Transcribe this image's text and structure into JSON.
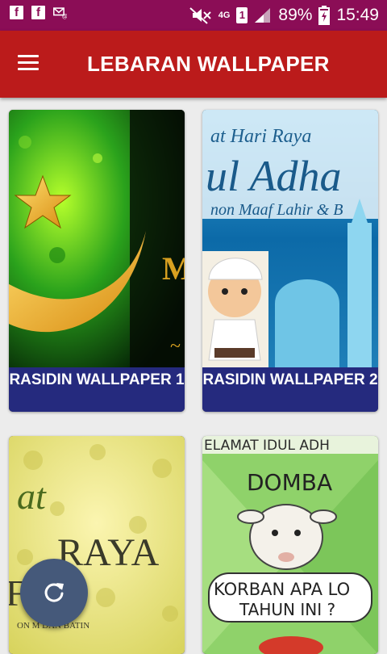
{
  "status_bar": {
    "battery": "89%",
    "time": "15:49",
    "network": "4G",
    "sim": "1"
  },
  "app_bar": {
    "title": "LEBARAN WALLPAPER"
  },
  "cards": [
    {
      "caption": "RASIDIN WALLPAPER 1",
      "art": "green-crescent-star"
    },
    {
      "caption": "RASIDIN WALLPAPER 2",
      "art": "idul-adha-mosque-boy",
      "image_text": [
        "at Hari Raya",
        "ul Adha",
        "non Maaf Lahir & B"
      ]
    },
    {
      "caption": "",
      "art": "yellow-raya-greeting",
      "image_text": [
        "at",
        "RAYA",
        "FRI",
        "ON M DAN BATIN"
      ]
    },
    {
      "caption": "",
      "art": "sheep-cartoon",
      "image_text": [
        "ELAMAT IDUL ADH",
        "DOMBA",
        "KORBAN APA LO",
        "TAHUN INI ?"
      ]
    }
  ],
  "colors": {
    "status_bar": "#8b0d56",
    "app_bar": "#bb1b1b",
    "caption_bg": "#252a7e",
    "fab": "#45597a"
  },
  "fab": {
    "icon": "refresh-icon"
  }
}
